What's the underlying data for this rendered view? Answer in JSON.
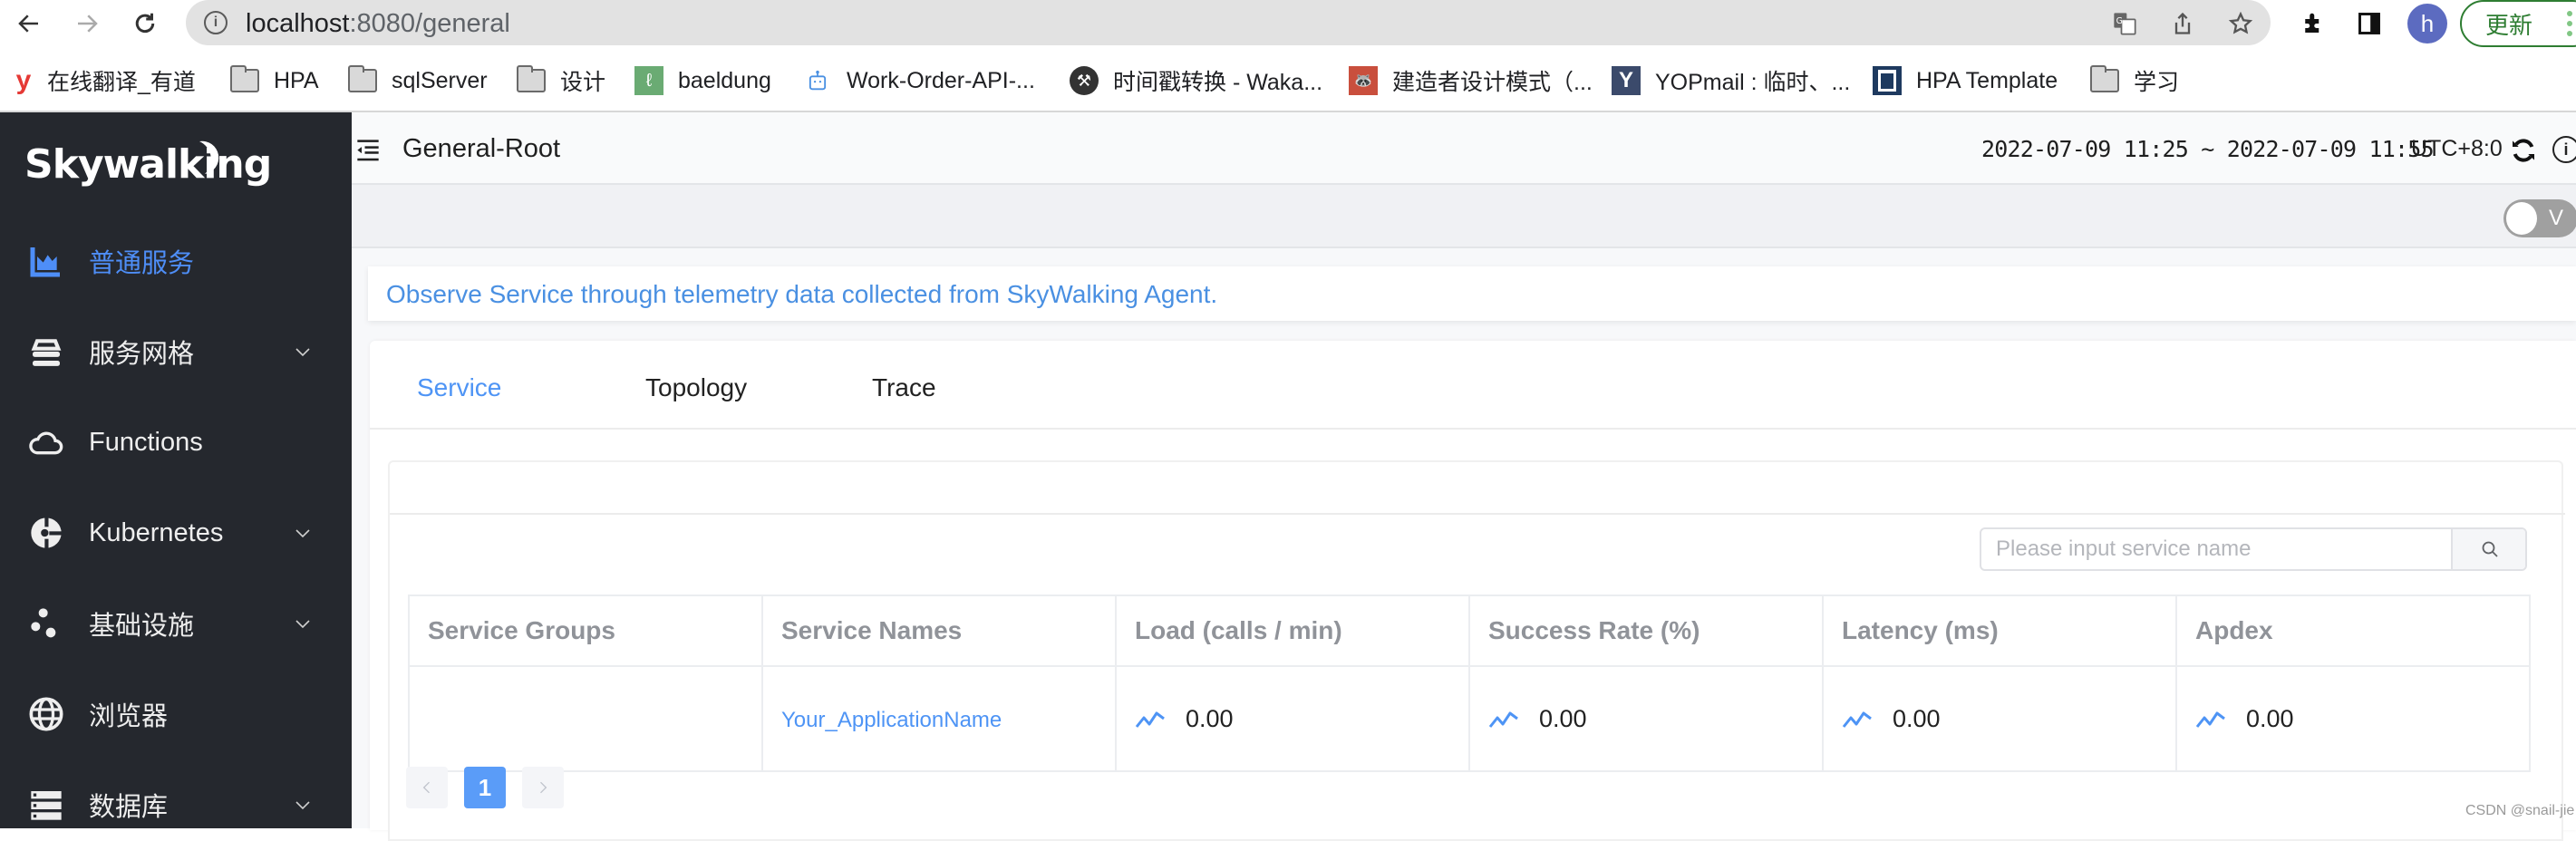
{
  "browser": {
    "url_host": "localhost",
    "url_path": ":8080/general",
    "profile_initial": "h",
    "update_label": "更新",
    "colors": {
      "update": "#2e7d32",
      "avatar": "#5c6bc0"
    }
  },
  "bookmarks": [
    {
      "label": "在线翻译_有道",
      "icon": "youdao-icon"
    },
    {
      "label": "HPA",
      "icon": "folder-icon"
    },
    {
      "label": "sqlServer",
      "icon": "folder-icon"
    },
    {
      "label": "设计",
      "icon": "folder-icon"
    },
    {
      "label": "baeldung",
      "icon": "baeldung-icon"
    },
    {
      "label": "Work-Order-API-...",
      "icon": "robot-icon"
    },
    {
      "label": "时间戳转换 - Waka...",
      "icon": "axe-icon"
    },
    {
      "label": "建造者设计模式（...",
      "icon": "raccoon-icon"
    },
    {
      "label": "YOPmail : 临时、...",
      "icon": "yopmail-icon"
    },
    {
      "label": "HPA Template",
      "icon": "window-icon"
    },
    {
      "label": "学习",
      "icon": "folder-icon"
    }
  ],
  "sidebar": {
    "logo": "Skywalking",
    "items": [
      {
        "label": "普通服务",
        "icon": "chart-area-icon",
        "active": true,
        "expandable": false
      },
      {
        "label": "服务网格",
        "icon": "layers-icon",
        "active": false,
        "expandable": true
      },
      {
        "label": "Functions",
        "icon": "cloud-icon",
        "active": false,
        "expandable": false
      },
      {
        "label": "Kubernetes",
        "icon": "kubernetes-icon",
        "active": false,
        "expandable": true
      },
      {
        "label": "基础设施",
        "icon": "dots-icon",
        "active": false,
        "expandable": true
      },
      {
        "label": "浏览器",
        "icon": "globe-icon",
        "active": false,
        "expandable": false
      },
      {
        "label": "数据库",
        "icon": "database-icon",
        "active": false,
        "expandable": true
      }
    ],
    "accent": "#4e8ef7"
  },
  "header": {
    "title": "General-Root",
    "time_range": "2022-07-09 11:25 ~ 2022-07-09 11:55",
    "timezone": "UTC+8:0",
    "toggle_label": "V"
  },
  "banner": {
    "text": "Observe Service through telemetry data collected from SkyWalking Agent."
  },
  "tabs": [
    {
      "label": "Service",
      "active": true
    },
    {
      "label": "Topology",
      "active": false
    },
    {
      "label": "Trace",
      "active": false
    }
  ],
  "search": {
    "placeholder": "Please input service name",
    "value": ""
  },
  "table": {
    "columns": [
      "Service Groups",
      "Service Names",
      "Load (calls / min)",
      "Success Rate (%)",
      "Latency (ms)",
      "Apdex"
    ],
    "rows": [
      {
        "group": "",
        "name": "Your_ApplicationName",
        "load": "0.00",
        "success_rate": "0.00",
        "latency": "0.00",
        "apdex": "0.00"
      }
    ]
  },
  "pagination": {
    "current": "1"
  },
  "watermark": "CSDN @snail-jie"
}
